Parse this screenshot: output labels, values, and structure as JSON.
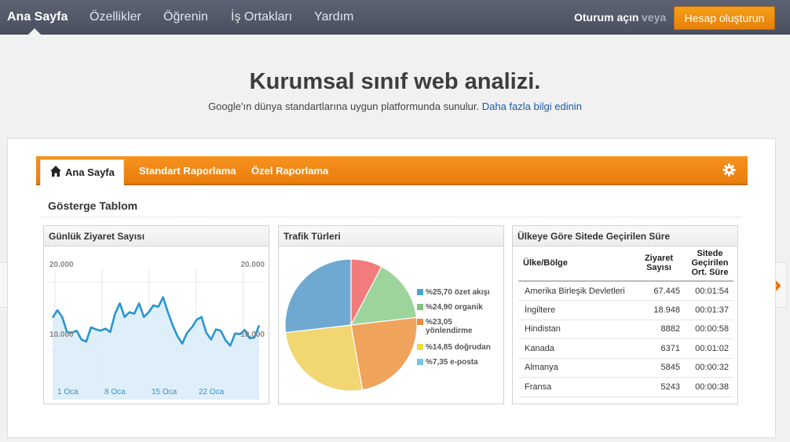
{
  "nav": {
    "items": [
      {
        "label": "Ana Sayfa",
        "active": true
      },
      {
        "label": "Özellikler"
      },
      {
        "label": "Öğrenin"
      },
      {
        "label": "İş Ortakları"
      },
      {
        "label": "Yardım"
      }
    ],
    "signin_label": "Oturum açın",
    "or_label": "veya",
    "create_account_label": "Hesap oluşturun"
  },
  "hero": {
    "title": "Kurumsal sınıf web analizi.",
    "subtitle": "Google'ın dünya standartlarına uygun platformunda sunulur.",
    "more_link": "Daha fazla bilgi edinin"
  },
  "tabs": {
    "home_label": "Ana Sayfa",
    "standard_label": "Standart Raporlama",
    "custom_label": "Özel Raporlama"
  },
  "dashboard_title": "Gösterge Tablom",
  "colors": {
    "accent": "#f08a17",
    "line": "#2b95cf",
    "link": "#1a5aa8"
  },
  "chart_data": [
    {
      "type": "line",
      "title": "Günlük Ziyaret Sayısı",
      "ylim": [
        0,
        20000
      ],
      "ytick_labels": [
        "20.000",
        "10.000"
      ],
      "xtick_labels": [
        "1 Oca",
        "8 Oca",
        "15 Oca",
        "22 Oca"
      ],
      "values": [
        13600,
        14700,
        13700,
        11500,
        11400,
        11700,
        10400,
        10100,
        12200,
        11900,
        11700,
        12000,
        11500,
        14200,
        15700,
        13700,
        14400,
        14200,
        15700,
        13700,
        14400,
        15400,
        15200,
        16600,
        14400,
        12500,
        10900,
        9800,
        11400,
        12200,
        13300,
        13700,
        11400,
        10400,
        11900,
        11700,
        10300,
        9500,
        11300,
        11200,
        11800,
        10600,
        10700,
        12500
      ]
    },
    {
      "type": "pie",
      "title": "Trafik Türleri",
      "slices": [
        {
          "label": "%25,70 özet akışı",
          "value": 25.7,
          "color": "#6fa9d2"
        },
        {
          "label": "%24,90 organik",
          "value": 24.9,
          "color": "#f2d671"
        },
        {
          "label": "%23,05 yönlendirme",
          "value": 23.05,
          "color": "#f0a35a"
        },
        {
          "label": "%14,85 doğrudan",
          "value": 14.85,
          "color": "#9dd49c"
        },
        {
          "label": "%7,35 e-posta",
          "value": 7.35,
          "color": "#f27b7b"
        }
      ]
    },
    {
      "type": "table",
      "title": "Ülkeye Göre Sitede Geçirilen Süre",
      "columns": [
        "Ülke/Bölge",
        "Ziyaret Sayısı",
        "Sitede Geçirilen Ort. Süre"
      ],
      "rows": [
        [
          "Amerika Birleşik Devletleri",
          "67.445",
          "00:01:54"
        ],
        [
          "İngiltere",
          "18.948",
          "00:01:37"
        ],
        [
          "Hindistan",
          "8882",
          "00:00:58"
        ],
        [
          "Kanada",
          "6371",
          "00:01:02"
        ],
        [
          "Almanya",
          "5845",
          "00:00:32"
        ],
        [
          "Fransa",
          "5243",
          "00:00:38"
        ]
      ]
    }
  ],
  "legend_colors": [
    "#47a5d8",
    "#7cc57a",
    "#ee8c3e",
    "#f1dc3a",
    "#74c7e6"
  ]
}
